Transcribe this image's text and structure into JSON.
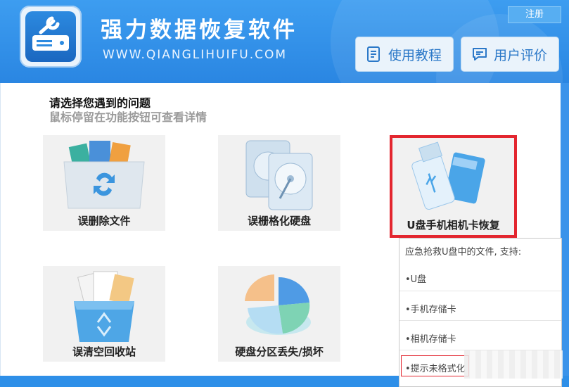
{
  "header": {
    "title": "强力数据恢复软件",
    "url": "WWW.QIANGLIHUIFU.COM",
    "register": "注册",
    "buttons": {
      "tutorial": "使用教程",
      "review": "用户评价"
    }
  },
  "prompt": {
    "line1": "请选择您遇到的问题",
    "line2": "鼠标停留在功能按钮可查看详情"
  },
  "cards": [
    {
      "label": "误删除文件",
      "icon": "folder-recycle-icon"
    },
    {
      "label": "误栅格化硬盘",
      "icon": "hard-drive-icon"
    },
    {
      "label": "U盘手机相机卡恢复",
      "icon": "usb-sdcard-icon",
      "selected": true
    },
    {
      "label": "误清空回收站",
      "icon": "recycle-bin-icon"
    },
    {
      "label": "硬盘分区丢失/损坏",
      "icon": "disk-pie-icon"
    }
  ],
  "tooltip": {
    "title": "应急抢救U盘中的文件, 支持:",
    "items": [
      "•U盘",
      "•手机存储卡",
      "•相机存储卡",
      "•提示未格式化"
    ]
  },
  "colors": {
    "header": "#2e8fe8",
    "highlight": "#e3262f",
    "card_bg": "#f1f1f1"
  }
}
